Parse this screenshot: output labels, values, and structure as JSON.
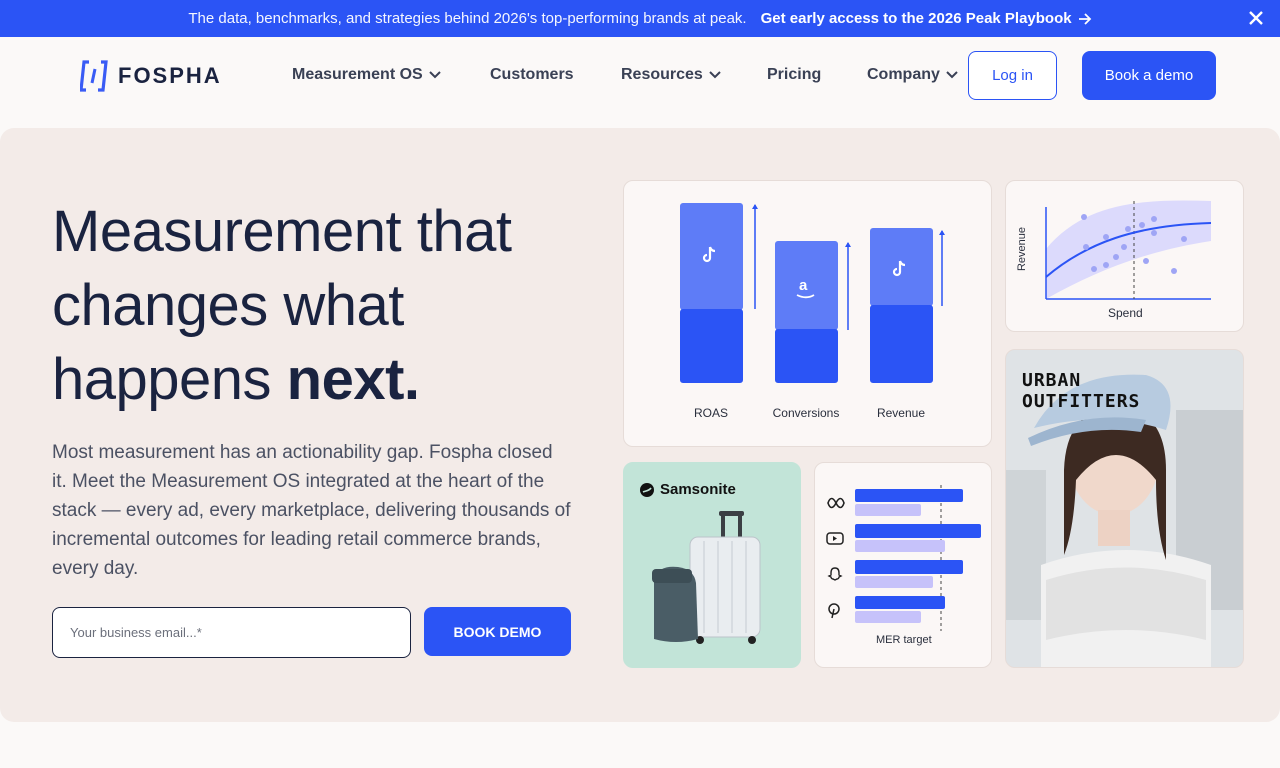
{
  "banner": {
    "message": "The data, benchmarks, and strategies behind 2026's top-performing brands at peak.",
    "cta": "Get early access to the 2026 Peak Playbook"
  },
  "nav": {
    "logo": "FOSPHA",
    "items": [
      "Measurement OS",
      "Customers",
      "Resources",
      "Pricing",
      "Company"
    ],
    "login": "Log in",
    "book_demo": "Book a demo"
  },
  "hero": {
    "headline_lines": [
      "Measurement that",
      "changes what",
      "happens "
    ],
    "headline_bold": "next.",
    "subtext": "Most measurement has an actionability gap. Fospha closed it. Meet the Measurement OS integrated at the heart of the stack — every ad, every marketplace, delivering thousands of incremental outcomes for leading retail commerce brands, every day.",
    "email_placeholder": "Your business email...*",
    "cta": "BOOK DEMO"
  },
  "cards": {
    "bars": {
      "labels": [
        "ROAS",
        "Conversions",
        "Revenue"
      ],
      "icons": [
        "tiktok-icon",
        "amazon-icon",
        "tiktok-icon"
      ]
    },
    "curve": {
      "ylabel": "Revenue",
      "xlabel": "Spend"
    },
    "samsonite": {
      "brand": "Samsonite"
    },
    "mer": {
      "label": "MER target",
      "icons": [
        "meta-icon",
        "youtube-icon",
        "snapchat-icon",
        "pinterest-icon"
      ]
    },
    "urban": {
      "line1": "URBAN",
      "line2": "OUTFITTERS"
    }
  },
  "colors": {
    "brand": "#2b54f5",
    "hero_bg": "#f3ebe8",
    "light_bar": "#5e7cf7",
    "lavender": "#c6c2fa"
  }
}
